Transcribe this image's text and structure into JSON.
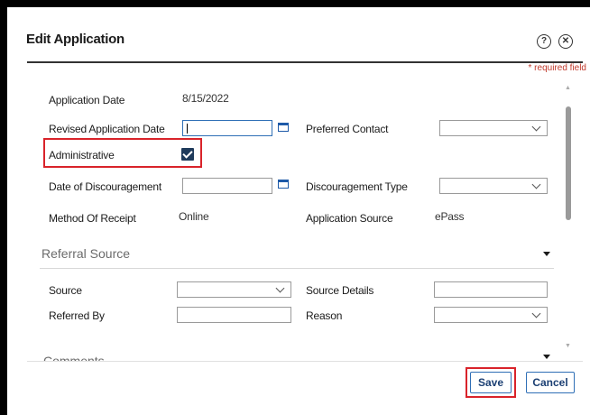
{
  "dialog": {
    "title": "Edit Application",
    "help_icon": "question-circle-icon",
    "close_icon": "close-circle-icon",
    "required_note": "* required field"
  },
  "fields": {
    "application_date_label": "Application Date",
    "application_date_value": "8/15/2022",
    "revised_date_label": "Revised Application Date",
    "revised_date_value": "",
    "preferred_contact_label": "Preferred Contact",
    "preferred_contact_value": "",
    "administrative_label": "Administrative",
    "administrative_checked": true,
    "discouragement_date_label": "Date of Discouragement",
    "discouragement_date_value": "",
    "discouragement_type_label": "Discouragement Type",
    "discouragement_type_value": "",
    "method_label": "Method Of Receipt",
    "method_value": "Online",
    "app_source_label": "Application Source",
    "app_source_value": "ePass"
  },
  "referral": {
    "section_title": "Referral Source",
    "source_label": "Source",
    "source_value": "",
    "source_details_label": "Source Details",
    "source_details_value": "",
    "referred_by_label": "Referred By",
    "referred_by_value": "",
    "reason_label": "Reason",
    "reason_value": ""
  },
  "comments": {
    "section_title": "Comments"
  },
  "buttons": {
    "save": "Save",
    "cancel": "Cancel"
  },
  "colors": {
    "highlight": "#d9232a",
    "checkbox": "#1f3b5c",
    "accent": "#2f6fb6"
  }
}
